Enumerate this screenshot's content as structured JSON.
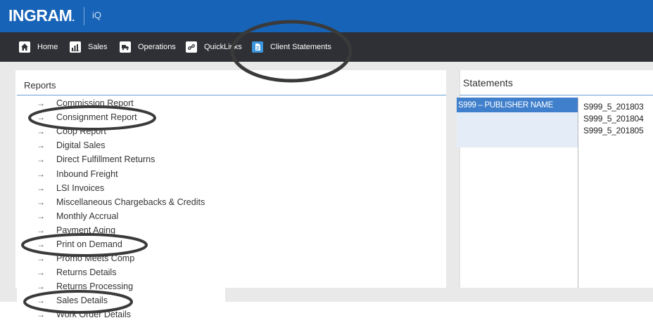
{
  "app": {
    "logo": "INGRAM",
    "logo_mark": ".",
    "name": "iQ"
  },
  "nav": [
    {
      "label": "Home",
      "icon": "home-icon"
    },
    {
      "label": "Sales",
      "icon": "bar-chart-icon"
    },
    {
      "label": "Operations",
      "icon": "truck-icon"
    },
    {
      "label": "QuickLinks",
      "icon": "link-icon"
    },
    {
      "label": "Client Statements",
      "icon": "document-icon"
    }
  ],
  "reports": {
    "title": "Reports",
    "arrow": "→",
    "items": [
      "Commission Report",
      "Consignment Report",
      "Coop Report",
      "Digital Sales",
      "Direct Fulfillment Returns",
      "Inbound Freight",
      "LSI Invoices",
      "Miscellaneous Chargebacks & Credits",
      "Monthly Accrual",
      "Payment Aging",
      "Print on Demand",
      "Promo Meets Comp",
      "Returns Details",
      "Returns Processing",
      "Sales Details",
      "Work Order Details"
    ]
  },
  "statements": {
    "title": "Statements",
    "publisher": "S999 – PUBLISHER NAME",
    "files": [
      "S999_5_201803",
      "S999_5_201804",
      "S999_5_201805"
    ]
  },
  "colors": {
    "topbar": "#1763b7",
    "navbar": "#2e3035",
    "selection": "#3f7fcc",
    "annotation": "#3a3a3a"
  }
}
